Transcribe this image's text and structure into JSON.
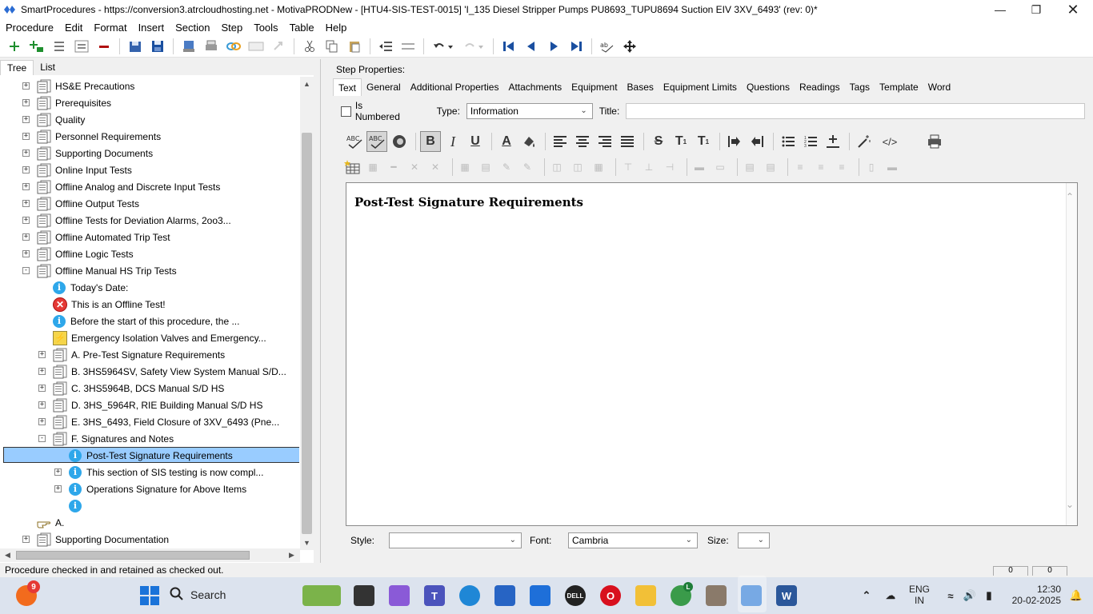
{
  "window": {
    "title": "SmartProcedures - https://conversion3.atrcloudhosting.net - MotivaPRODNew - [HTU4-SIS-TEST-0015] 'I_135 Diesel Stripper Pumps PU8693_TUPU8694 Suction EIV 3XV_6493' (rev: 0)*"
  },
  "menu": [
    "Procedure",
    "Edit",
    "Format",
    "Insert",
    "Section",
    "Step",
    "Tools",
    "Table",
    "Help"
  ],
  "left_tabs": [
    "Tree",
    "List"
  ],
  "tree": [
    {
      "label": "HS&E Precautions",
      "level": 0,
      "icon": "doc",
      "expander": "+"
    },
    {
      "label": "Prerequisites",
      "level": 0,
      "icon": "doc",
      "expander": "+"
    },
    {
      "label": "Quality",
      "level": 0,
      "icon": "doc",
      "expander": "+"
    },
    {
      "label": "Personnel Requirements",
      "level": 0,
      "icon": "doc",
      "expander": "+"
    },
    {
      "label": "Supporting Documents",
      "level": 0,
      "icon": "doc",
      "expander": "+"
    },
    {
      "label": "Online Input Tests",
      "level": 0,
      "icon": "doc",
      "expander": "+"
    },
    {
      "label": "Offline Analog and Discrete Input Tests",
      "level": 0,
      "icon": "doc",
      "expander": "+"
    },
    {
      "label": "Offline Output Tests",
      "level": 0,
      "icon": "doc",
      "expander": "+"
    },
    {
      "label": "Offline Tests for Deviation Alarms, 2oo3...",
      "level": 0,
      "icon": "doc",
      "expander": "+"
    },
    {
      "label": "Offline Automated Trip Test",
      "level": 0,
      "icon": "doc",
      "expander": "+"
    },
    {
      "label": "Offline Logic Tests",
      "level": 0,
      "icon": "doc",
      "expander": "+"
    },
    {
      "label": "Offline Manual HS Trip Tests",
      "level": 0,
      "icon": "doc",
      "expander": "-"
    },
    {
      "label": "Today's Date:",
      "level": 1,
      "icon": "info",
      "expander": ""
    },
    {
      "label": "This is an Offline Test!",
      "level": 1,
      "icon": "error",
      "expander": ""
    },
    {
      "label": "Before the start of this procedure, the ...",
      "level": 1,
      "icon": "info",
      "expander": ""
    },
    {
      "label": "Emergency Isolation Valves and Emergency...",
      "level": 1,
      "icon": "warn",
      "expander": ""
    },
    {
      "label": "A. Pre-Test Signature Requirements",
      "level": 1,
      "icon": "doc",
      "expander": "+"
    },
    {
      "label": "B. 3HS5964SV, Safety View System Manual S/D...",
      "level": 1,
      "icon": "doc",
      "expander": "+"
    },
    {
      "label": "C. 3HS5964B, DCS Manual S/D HS",
      "level": 1,
      "icon": "doc",
      "expander": "+"
    },
    {
      "label": "D. 3HS_5964R, RIE Building Manual S/D HS",
      "level": 1,
      "icon": "doc",
      "expander": "+"
    },
    {
      "label": "E. 3HS_6493, Field Closure of 3XV_6493 (Pne...",
      "level": 1,
      "icon": "doc",
      "expander": "+"
    },
    {
      "label": "F. Signatures and Notes",
      "level": 1,
      "icon": "doc",
      "expander": "-"
    },
    {
      "label": "Post-Test Signature Requirements",
      "level": 2,
      "icon": "info",
      "expander": "",
      "selected": true
    },
    {
      "label": "This section of SIS testing is now compl...",
      "level": 2,
      "icon": "info",
      "expander": "+"
    },
    {
      "label": "Operations Signature for Above Items",
      "level": 2,
      "icon": "info",
      "expander": "+"
    },
    {
      "label": "",
      "level": 2,
      "icon": "info",
      "expander": ""
    },
    {
      "label": "A.",
      "level": 0,
      "icon": "hand",
      "expander": ""
    },
    {
      "label": "Supporting Documentation",
      "level": 0,
      "icon": "doc",
      "expander": "+"
    }
  ],
  "step_properties": {
    "label": "Step Properties:",
    "tabs": [
      "Text",
      "General",
      "Additional Properties",
      "Attachments",
      "Equipment",
      "Bases",
      "Equipment Limits",
      "Questions",
      "Readings",
      "Tags",
      "Template",
      "Word"
    ],
    "active_tab": "Text",
    "is_numbered_label": "Is Numbered",
    "type_label": "Type:",
    "type_value": "Information",
    "title_label": "Title:",
    "title_value": ""
  },
  "editor": {
    "content_heading": "Post-Test Signature Requirements"
  },
  "format_bar": {
    "style_label": "Style:",
    "style_value": "",
    "font_label": "Font:",
    "font_value": "Cambria",
    "size_label": "Size:",
    "size_value": ""
  },
  "status": {
    "message": "Procedure checked in and retained as checked out.",
    "box1": "0",
    "box2": "0"
  },
  "taskbar": {
    "search_label": "Search",
    "notification_count": "9",
    "chrome_badge": "L",
    "lang_line1": "ENG",
    "lang_line2": "IN",
    "time": "12:30",
    "date": "20-02-2025"
  },
  "colors": {
    "selection": "#99ccff",
    "info_icon": "#2ea7ea",
    "error_icon": "#e53935",
    "toolbar_blue": "#1a4fa0",
    "toolbar_green": "#1e8f2e"
  }
}
